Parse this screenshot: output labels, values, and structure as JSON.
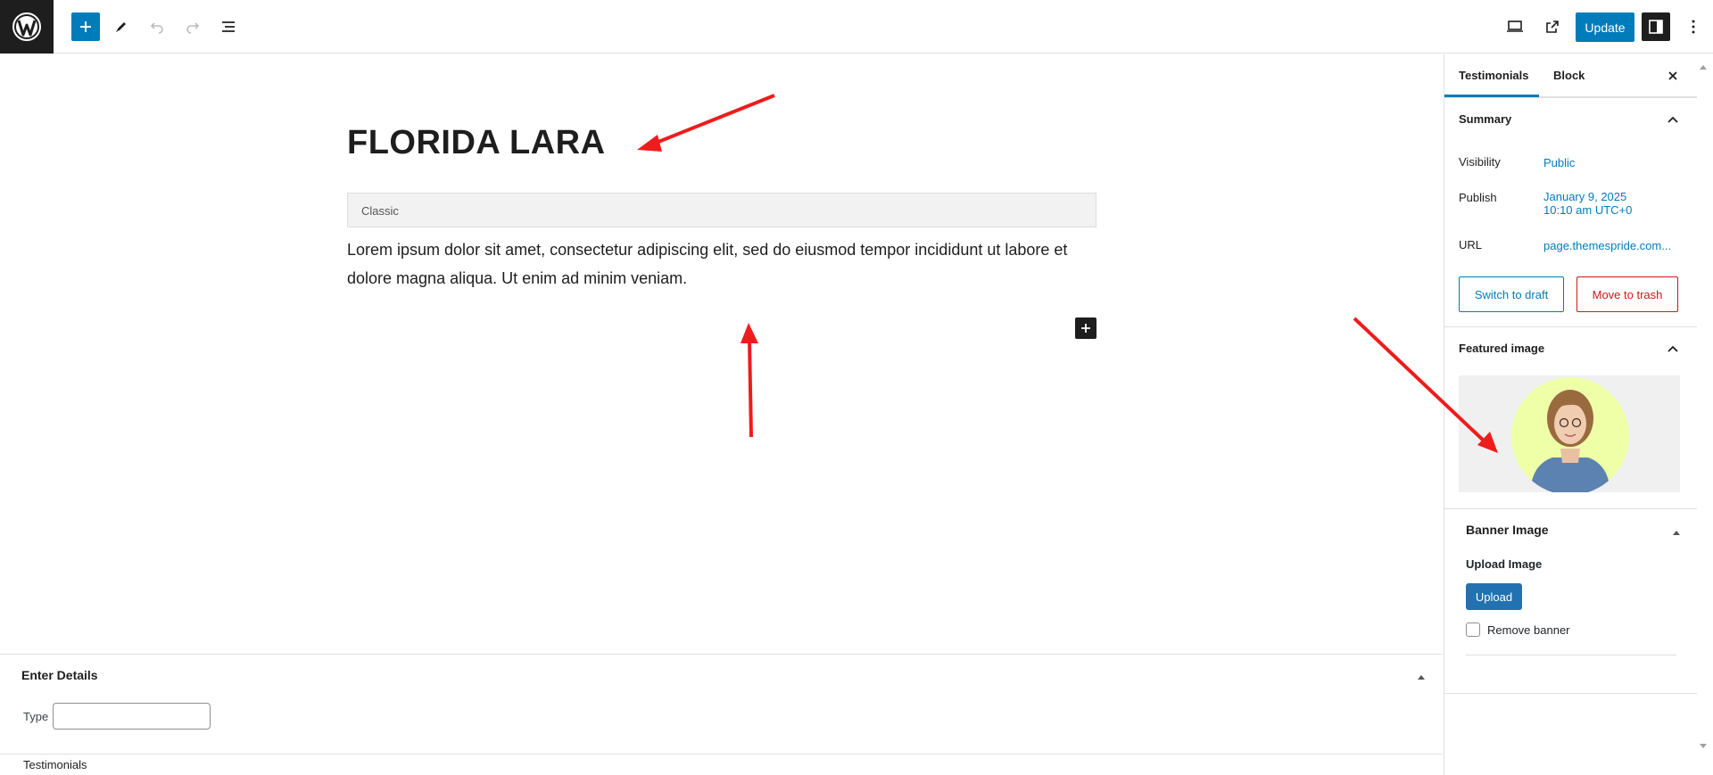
{
  "toolbar": {
    "update_label": "Update",
    "icons": [
      "wordpress-logo",
      "plus",
      "pencil",
      "undo",
      "redo",
      "list-view",
      "desktop-preview",
      "external-link",
      "sidebar-toggle",
      "more-vertical"
    ]
  },
  "editor": {
    "title": "FLORIDA LARA",
    "classic_label": "Classic",
    "body": "Lorem ipsum dolor sit amet, consectetur adipiscing elit, sed do eiusmod tempor incididunt ut labore et dolore magna aliqua. Ut enim ad minim veniam."
  },
  "metabox": {
    "title": "Enter Details",
    "type_label": "Type",
    "type_value": ""
  },
  "footer": {
    "breadcrumb": "Testimonials"
  },
  "sidebar": {
    "tabs": [
      {
        "label": "Testimonials",
        "active": true
      },
      {
        "label": "Block",
        "active": false
      }
    ],
    "summary": {
      "title": "Summary",
      "visibility_label": "Visibility",
      "visibility_value": "Public",
      "publish_label": "Publish",
      "publish_date": "January 9, 2025",
      "publish_time": "10:10 am UTC+0",
      "url_label": "URL",
      "url_value": "page.themespride.com...",
      "switch_draft": "Switch to draft",
      "move_trash": "Move to trash"
    },
    "featured_image": {
      "title": "Featured image"
    },
    "banner": {
      "title": "Banner Image",
      "upload_label": "Upload Image",
      "upload_button": "Upload",
      "remove_label": "Remove banner",
      "remove_checked": false
    }
  },
  "colors": {
    "accent": "#007cba",
    "danger": "#cc1818",
    "annotation": "#ee1c1c"
  }
}
